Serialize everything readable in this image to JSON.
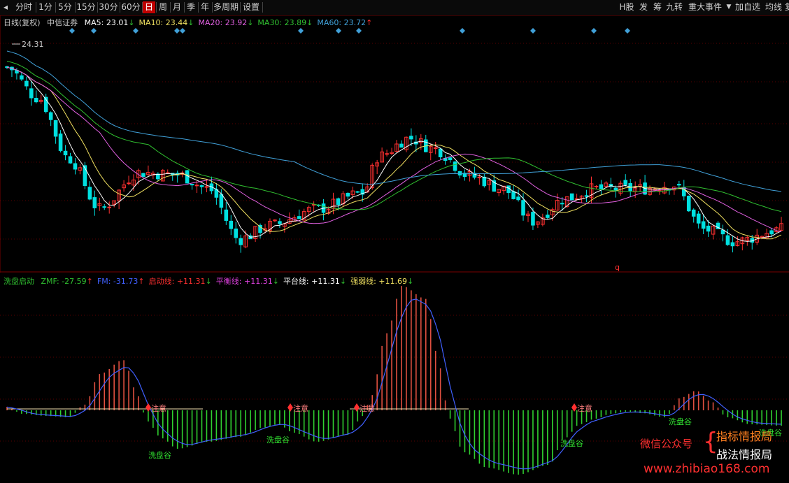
{
  "toolbar": {
    "left_buttons": [
      "分时",
      "1分",
      "5分",
      "15分",
      "30分",
      "60分",
      "日",
      "周",
      "月",
      "季",
      "年",
      "多周期",
      "设置"
    ],
    "active": "日",
    "right_buttons": [
      "H股",
      "发",
      "筹",
      "九转",
      "重大事件",
      "加自选",
      "均线",
      "复"
    ],
    "dropdown_icon": "triangle-down-icon"
  },
  "main": {
    "period_label": "日线(复权)",
    "stock_name": "中信证券",
    "ma": [
      {
        "label": "MA5:",
        "value": "23.01",
        "arrow": "↓",
        "color": "#ffffff"
      },
      {
        "label": "MA10:",
        "value": "23.44",
        "arrow": "↓",
        "color": "#f0e060"
      },
      {
        "label": "MA20:",
        "value": "23.92",
        "arrow": "↓",
        "color": "#e060e0"
      },
      {
        "label": "MA30:",
        "value": "23.89",
        "arrow": "↓",
        "color": "#30c030"
      },
      {
        "label": "MA60:",
        "value": "23.72",
        "arrow": "↑",
        "color": "#40a0d8"
      }
    ],
    "max_label": "24.31",
    "marker_q": "q"
  },
  "sub": {
    "indicator_name": "洗盘启动",
    "params": [
      {
        "label": "ZMF:",
        "value": "-27.59",
        "arrow": "↑",
        "color": "#30c030"
      },
      {
        "label": "FM:",
        "value": "-31.73",
        "arrow": "↑",
        "color": "#4060ff"
      },
      {
        "label": "启动线:",
        "value": "+11.31",
        "arrow": "↓",
        "color": "#ff3030"
      },
      {
        "label": "平衡线:",
        "value": "+11.31",
        "arrow": "↓",
        "color": "#e040e0"
      },
      {
        "label": "平台线:",
        "value": "+11.31",
        "arrow": "↓",
        "color": "#ffffff"
      },
      {
        "label": "强弱线:",
        "value": "+11.69",
        "arrow": "↓",
        "color": "#f0e060"
      }
    ],
    "valley_label": "洗盘谷",
    "attention_label": "注意"
  },
  "watermark": {
    "wechat": "微信公众号",
    "line1": "指标情报局",
    "line2": "战法情报局",
    "url": "www.zhibiao168.com"
  },
  "colors": {
    "up": "#ff3030",
    "down": "#00e0e0",
    "grid": "#5a0000",
    "hist_up": "#e05040",
    "hist_down": "#30d030",
    "fm_line": "#4060ff"
  }
}
